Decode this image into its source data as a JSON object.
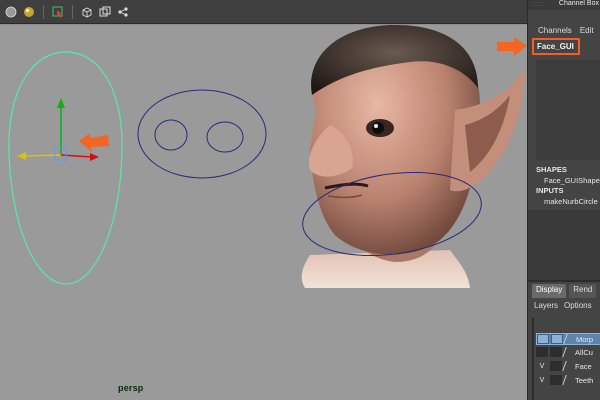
{
  "toolbar": {
    "icons": [
      "sphere-shade-icon",
      "sphere-light-icon",
      "select-tool-icon",
      "cube-icon",
      "duplicate-icon",
      "hierarchy-icon"
    ]
  },
  "viewport": {
    "camera_label": "persp",
    "colors": {
      "background": "#9a9a9a",
      "curve_selected": "#5fe0a4",
      "curve_default": "#2a2a7a",
      "arrow_annotation": "#f26522",
      "axis_x": "#d01010",
      "axis_y": "#10b010",
      "axis_z": "#e0c000"
    }
  },
  "channel_box": {
    "title": "Channel Box",
    "menus": [
      "Channels",
      "Edit"
    ],
    "node_name": "Face_GUI",
    "shapes_label": "SHAPES",
    "shape_item": "Face_GUIShape",
    "inputs_label": "INPUTS",
    "input_item": "makeNurbCircle"
  },
  "layer_editor": {
    "tabs": [
      "Display",
      "Rend"
    ],
    "menus": [
      "Layers",
      "Options"
    ],
    "layers": [
      {
        "visibility": "",
        "name": "Morp",
        "selected": true
      },
      {
        "visibility": "",
        "name": "AllCu",
        "selected": false
      },
      {
        "visibility": "V",
        "name": "Face",
        "selected": false
      },
      {
        "visibility": "V",
        "name": "Teeth",
        "selected": false
      }
    ]
  }
}
